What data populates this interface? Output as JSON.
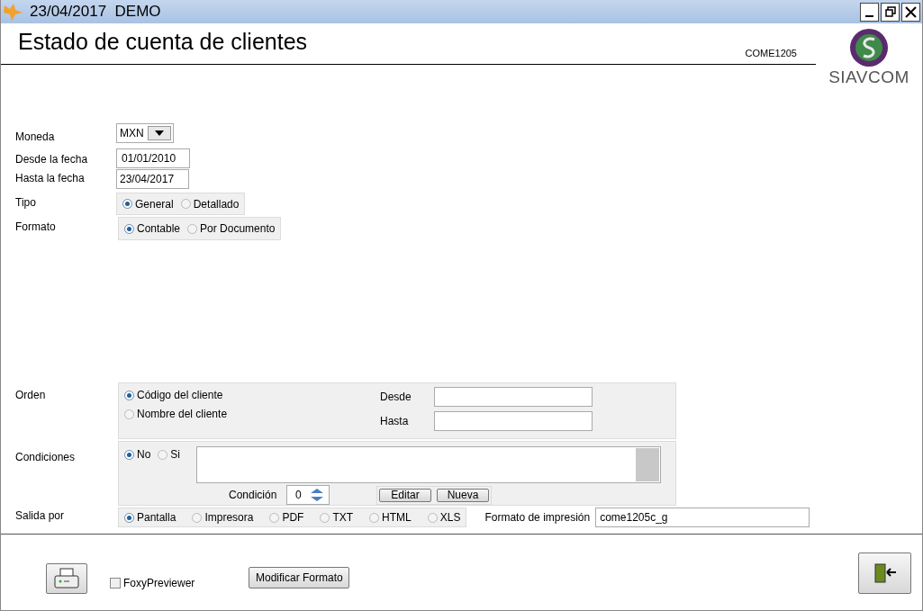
{
  "window": {
    "title": "23/04/2017  DEMO"
  },
  "header": {
    "title": "Estado de cuenta de clientes",
    "code": "COME1205",
    "logo_text": "SIAVCOM"
  },
  "moneda": {
    "label": "Moneda",
    "value": "MXN"
  },
  "desde_fecha": {
    "label": "Desde la fecha",
    "value": "01/01/2010"
  },
  "hasta_fecha": {
    "label": "Hasta la fecha",
    "value": "23/04/2017"
  },
  "tipo": {
    "label": "Tipo",
    "options": [
      {
        "label": "General",
        "selected": true
      },
      {
        "label": "Detallado",
        "selected": false
      }
    ]
  },
  "formato": {
    "label": "Formato",
    "options": [
      {
        "label": "Contable",
        "selected": true
      },
      {
        "label": "Por Documento",
        "selected": false
      }
    ]
  },
  "orden": {
    "label": "Orden",
    "options": [
      {
        "label": "Código del cliente",
        "selected": true
      },
      {
        "label": "Nombre del cliente",
        "selected": false
      }
    ],
    "desde_label": "Desde",
    "hasta_label": "Hasta"
  },
  "condiciones": {
    "label": "Condiciones",
    "options": [
      {
        "label": "No",
        "selected": true
      },
      {
        "label": "Si",
        "selected": false
      }
    ],
    "condicion_label": "Condición",
    "condicion_value": "0",
    "buttons": [
      "Editar",
      "Nueva"
    ]
  },
  "salida": {
    "label": "Salida por",
    "options": [
      {
        "label": "Pantalla",
        "selected": true
      },
      {
        "label": "Impresora",
        "selected": false
      },
      {
        "label": "PDF",
        "selected": false
      },
      {
        "label": "TXT",
        "selected": false
      },
      {
        "label": "HTML",
        "selected": false
      },
      {
        "label": "XLS",
        "selected": false
      }
    ],
    "formato_label": "Formato de impresión",
    "formato_value": "come1205c_g"
  },
  "footer": {
    "foxy": {
      "label": "FoxyPreviewer",
      "checked": false
    },
    "modificar": "Modificar Formato"
  }
}
